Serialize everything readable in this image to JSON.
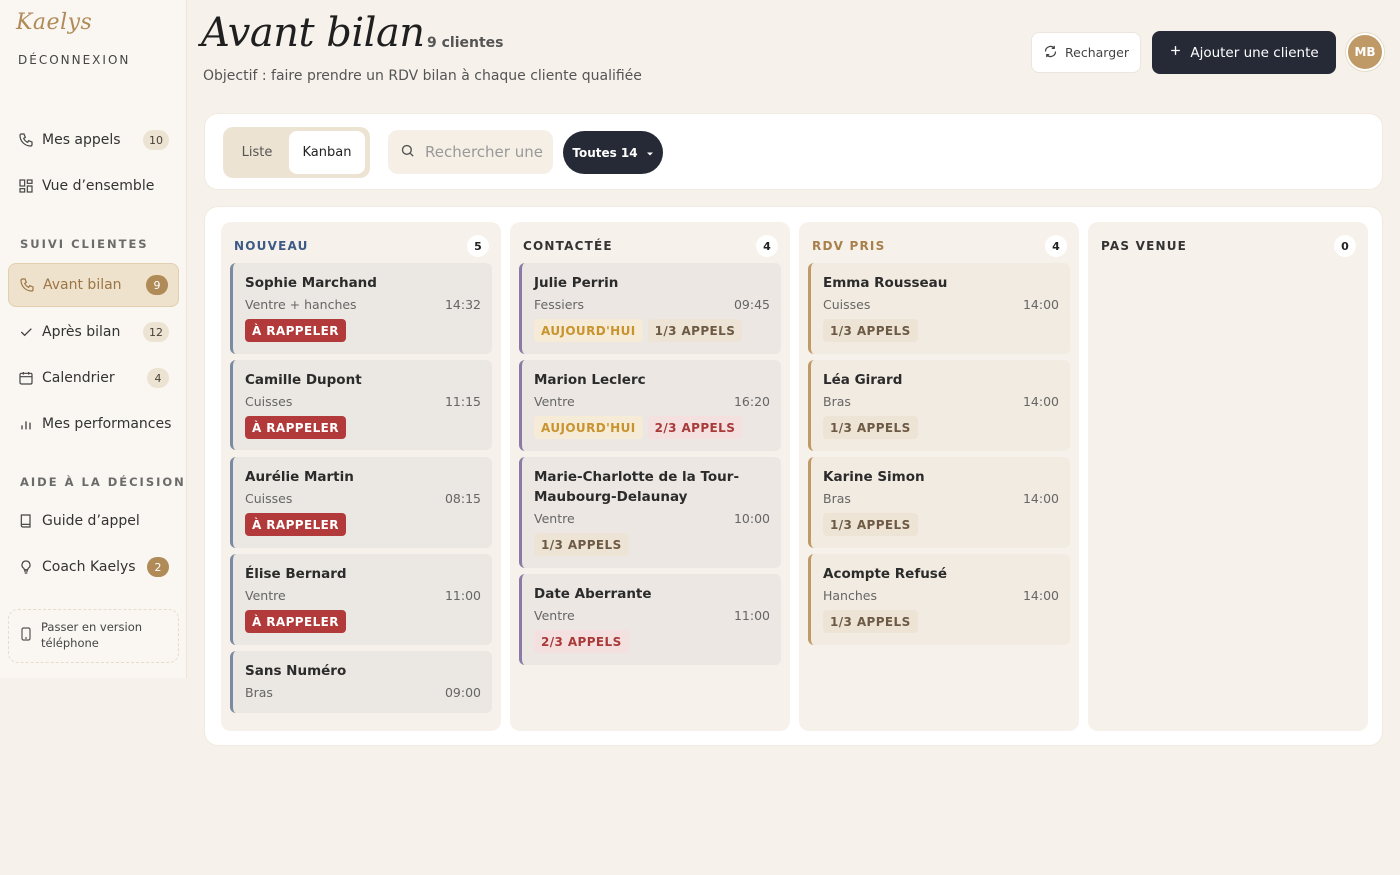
{
  "app": {
    "logo": "Kaelys",
    "logout": "DÉCONNEXION"
  },
  "sidebar": {
    "items": [
      {
        "label": "Mes appels",
        "count": "10",
        "icon": "phone-icon"
      },
      {
        "label": "Vue d’ensemble",
        "count": "",
        "icon": "grid-icon"
      }
    ],
    "section1": "SUIVI CLIENTES",
    "followup": [
      {
        "label": "Avant bilan",
        "count": "9",
        "icon": "phone-icon",
        "active": true
      },
      {
        "label": "Après bilan",
        "count": "12",
        "icon": "check-icon"
      },
      {
        "label": "Calendrier",
        "count": "4",
        "icon": "calendar-icon"
      },
      {
        "label": "Mes performances",
        "count": "",
        "icon": "bar-chart-icon"
      }
    ],
    "section2": "AIDE À LA DÉCISION",
    "decision": [
      {
        "label": "Guide d’appel",
        "count": "",
        "icon": "book-icon"
      },
      {
        "label": "Coach Kaelys",
        "count": "2",
        "icon": "lightbulb-icon"
      }
    ],
    "phone_mode": "Passer en version téléphone"
  },
  "header": {
    "title": "Avant bilan",
    "count": "9 clientes",
    "subtitle": "Objectif : faire prendre un RDV bilan à chaque cliente qualifiée",
    "reload": "Recharger",
    "add": "Ajouter une cliente",
    "avatar": "MB"
  },
  "toolbar": {
    "liste": "Liste",
    "kanban": "Kanban",
    "search_placeholder": "Rechercher une cliente",
    "filter": "Toutes 14"
  },
  "columns": [
    {
      "title": "NOUVEAU",
      "count": "5",
      "color": "#3e5a86",
      "cards": [
        {
          "name": "Sophie Marchand",
          "zone": "Ventre + hanches",
          "time": "14:32",
          "tags": [
            "À RAPPELER"
          ]
        },
        {
          "name": "Camille Dupont",
          "zone": "Cuisses",
          "time": "11:15",
          "tags": [
            "À RAPPELER"
          ]
        },
        {
          "name": "Aurélie Martin",
          "zone": "Cuisses",
          "time": "08:15",
          "tags": [
            "À RAPPELER"
          ]
        },
        {
          "name": "Élise Bernard",
          "zone": "Ventre",
          "time": "11:00",
          "tags": [
            "À RAPPELER"
          ]
        },
        {
          "name": "Sans Numéro",
          "zone": "Bras",
          "time": "09:00",
          "tags": []
        }
      ]
    },
    {
      "title": "CONTACTÉE",
      "count": "4",
      "color": "#333333",
      "cards": [
        {
          "name": "Julie Perrin",
          "zone": "Fessiers",
          "time": "09:45",
          "tags": [
            "AUJOURD'HUI",
            "1/3 APPELS"
          ]
        },
        {
          "name": "Marion Leclerc",
          "zone": "Ventre",
          "time": "16:20",
          "tags": [
            "AUJOURD'HUI",
            "2/3 APPELS"
          ]
        },
        {
          "name": "Marie-Charlotte de la Tour-Maubourg-Delaunay",
          "zone": "Ventre",
          "time": "10:00",
          "tags": [
            "1/3 APPELS"
          ]
        },
        {
          "name": "Date Aberrante",
          "zone": "Ventre",
          "time": "11:00",
          "tags": [
            "2/3 APPELS"
          ]
        }
      ]
    },
    {
      "title": "RDV PRIS",
      "count": "4",
      "color": "#a8804c",
      "cards": [
        {
          "name": "Emma Rousseau",
          "zone": "Cuisses",
          "time": "14:00",
          "tags": [
            "1/3 APPELS"
          ]
        },
        {
          "name": "Léa Girard",
          "zone": "Bras",
          "time": "14:00",
          "tags": [
            "1/3 APPELS"
          ]
        },
        {
          "name": "Karine Simon",
          "zone": "Bras",
          "time": "14:00",
          "tags": [
            "1/3 APPELS"
          ]
        },
        {
          "name": "Acompte Refusé",
          "zone": "Hanches",
          "time": "14:00",
          "tags": [
            "1/3 APPELS"
          ]
        }
      ]
    },
    {
      "title": "PAS VENUE",
      "count": "0",
      "color": "#333333",
      "cards": []
    }
  ]
}
